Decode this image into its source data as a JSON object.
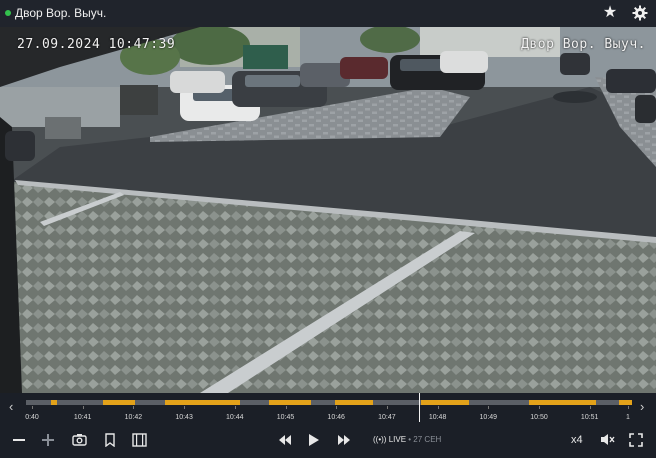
{
  "header": {
    "camera_title": "Двор Вор. Выуч.",
    "favorite_icon": "star-icon",
    "settings_icon": "gear-icon",
    "status_color": "#33c24d"
  },
  "video": {
    "osd_datetime": "27.09.2024 10:47:39",
    "osd_camera_name": "Двор Вор. Выуч."
  },
  "timeline": {
    "left_arrow": "‹",
    "right_arrow": "›",
    "ticks": [
      "0:40",
      "10:41",
      "10:42",
      "10:43",
      "10:44",
      "10:45",
      "10:46",
      "10:47",
      "10:48",
      "10:49",
      "10:50",
      "10:51",
      "1"
    ],
    "recording_color": "#e3a21a",
    "current_time": "10:47:39"
  },
  "controls": {
    "zoom_out_icon": "minus-icon",
    "zoom_in_icon": "plus-icon",
    "snapshot_icon": "camera-icon",
    "bookmark_icon": "bookmark-icon",
    "clip_icon": "film-icon",
    "rewind_icon": "rewind-icon",
    "play_icon": "play-icon",
    "forward_icon": "fast-forward-icon",
    "live_label": "LIVE",
    "live_date": "• 27 СЕН",
    "speed_label": "x4",
    "mute_icon": "mute-icon",
    "fullscreen_icon": "fullscreen-icon"
  }
}
